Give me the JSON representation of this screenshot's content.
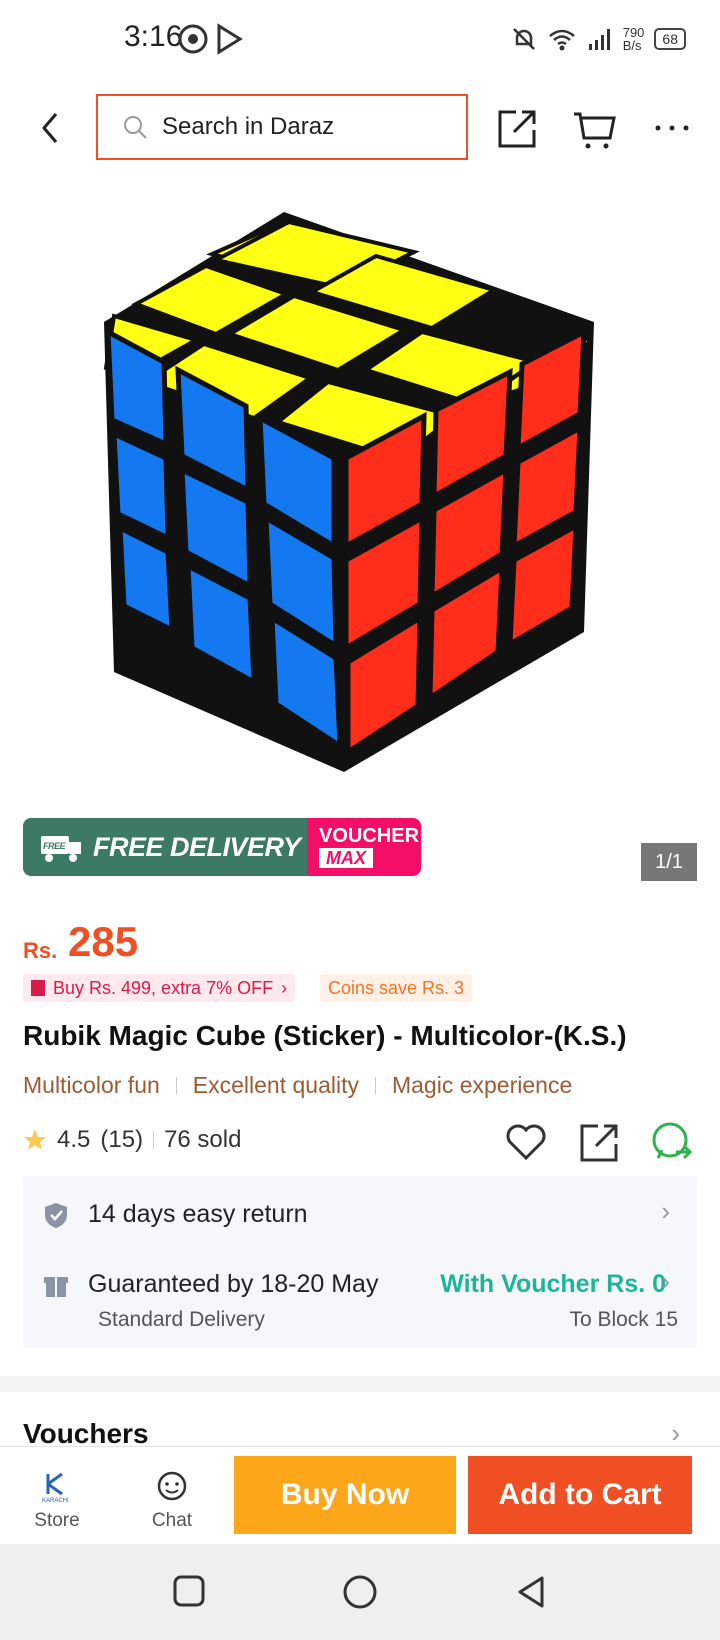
{
  "status": {
    "time": "3:16",
    "speed_top": "790",
    "speed_unit": "B/s",
    "battery": "68"
  },
  "search": {
    "placeholder": "Search in Daraz"
  },
  "gallery": {
    "counter": "1/1"
  },
  "promo": {
    "free_badge": "FREE",
    "free_delivery": "FREE DELIVERY",
    "voucher": "VOUCHER",
    "max": "MAX"
  },
  "price": {
    "currency": "Rs.",
    "amount": "285",
    "promo_chip": "Buy Rs. 499, extra 7% OFF",
    "coins_chip": "Coins save Rs. 3"
  },
  "product": {
    "title": "Rubik Magic Cube (Sticker) - Multicolor-(K.S.)",
    "tags": [
      "Multicolor fun",
      "Excellent quality",
      "Magic experience"
    ],
    "rating": "4.5",
    "reviews": "(15)",
    "sold": "76 sold"
  },
  "info": {
    "return": "14 days easy return",
    "delivery": "Guaranteed by 18-20 May",
    "voucher_note": "With Voucher Rs. 0",
    "delivery_type": "Standard Delivery",
    "location": "To Block 15"
  },
  "sections": {
    "vouchers": "Vouchers"
  },
  "bottom": {
    "store": "Store",
    "store_logo": "KARACHI",
    "chat": "Chat",
    "buy_now": "Buy Now",
    "add_to_cart": "Add to Cart"
  },
  "colors": {
    "brand": "#f04e23",
    "buy": "#fea61a",
    "green": "#1cb59a"
  }
}
